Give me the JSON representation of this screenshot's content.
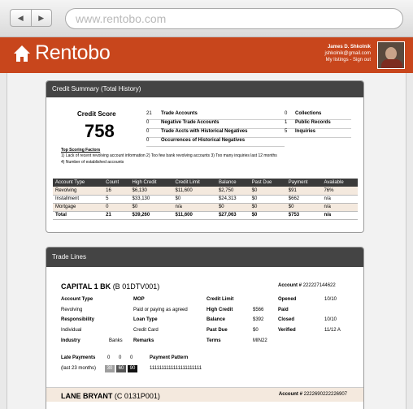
{
  "browser": {
    "url": "www.rentobo.com",
    "back": "◀",
    "forward": "▶"
  },
  "header": {
    "brand": "Rentobo",
    "user_name": "James D. Shkolnik",
    "user_email": "jshkolnik@gmail.com",
    "links": "My listings - Sign out"
  },
  "credit": {
    "title": "Credit Summary (Total History)",
    "score_label": "Credit Score",
    "score": "758",
    "stats_left": [
      {
        "num": "21",
        "label": "Trade Accounts"
      },
      {
        "num": "0",
        "label": "Negative Trade Accounts"
      },
      {
        "num": "0",
        "label": "Trade Accts with Historical Negatives"
      },
      {
        "num": "0",
        "label": "Occurrences of Historical Negatives"
      }
    ],
    "stats_right": [
      {
        "num": "0",
        "label": "Collections"
      },
      {
        "num": "1",
        "label": "Public Records"
      },
      {
        "num": "5",
        "label": "Inquiries"
      }
    ],
    "factors_title": "Top Scoring Factors",
    "factors_line1": "1) Lack of recent revolving account information   2) Too few bank revolving accounts   3) Too many inquiries last 12 months",
    "factors_line2": "4) Number of established accounts",
    "table": {
      "headers": [
        "Account Type",
        "Count",
        "High Credit",
        "Credit Limit",
        "Balance",
        "Past Due",
        "Payment",
        "Available"
      ],
      "rows": [
        [
          "Revolving",
          "16",
          "$6,130",
          "$11,600",
          "$2,750",
          "$0",
          "$91",
          "76%"
        ],
        [
          "Installment",
          "5",
          "$33,130",
          "$0",
          "$24,313",
          "$0",
          "$662",
          "n/a"
        ],
        [
          "Mortgage",
          "0",
          "$0",
          "n/a",
          "$0",
          "$0",
          "$0",
          "n/a"
        ],
        [
          "Total",
          "21",
          "$39,260",
          "$11,600",
          "$27,063",
          "$0",
          "$753",
          "n/a"
        ]
      ]
    }
  },
  "trade": {
    "title": "Trade Lines",
    "line1": {
      "name": "CAPITAL 1 BK",
      "code": "(B 01DTV001)",
      "account_label": "Account #",
      "account": "222227144622",
      "account_type_label": "Account Type",
      "account_type": "Revolving",
      "responsibility_label": "Responsibility",
      "responsibility": "Individual",
      "industry_label": "Industry",
      "industry": "Banks",
      "mop_label": "MOP",
      "mop": "Paid or paying as agreed",
      "loan_type_label": "Loan Type",
      "loan_type": "Credit Card",
      "remarks_label": "Remarks",
      "credit_limit_label": "Credit Limit",
      "high_credit_label": "High Credit",
      "high_credit": "$566",
      "balance_label": "Balance",
      "balance": "$392",
      "past_due_label": "Past Due",
      "past_due": "$0",
      "terms_label": "Terms",
      "terms": "MIN22",
      "opened_label": "Opened",
      "opened": "10/10",
      "paid_label": "Paid",
      "closed_label": "Closed",
      "closed": "10/10",
      "verified_label": "Verified",
      "verified": "11/12 A",
      "late_payments_label": "Late Payments",
      "late_counts": [
        "0",
        "0",
        "0"
      ],
      "late_period": "(last 23 months)",
      "late_buckets": [
        "30",
        "60",
        "90"
      ],
      "payment_pattern_label": "Payment Pattern",
      "payment_pattern": "1111111111111111111111"
    },
    "line2": {
      "name": "LANE BRYANT",
      "code": "(C 0131P001)",
      "account_label": "Account #",
      "account": "2222690222226907"
    }
  },
  "colors": {
    "brand": "#c8461c",
    "panel_head": "#444444",
    "row_alt": "#f4e9de"
  }
}
